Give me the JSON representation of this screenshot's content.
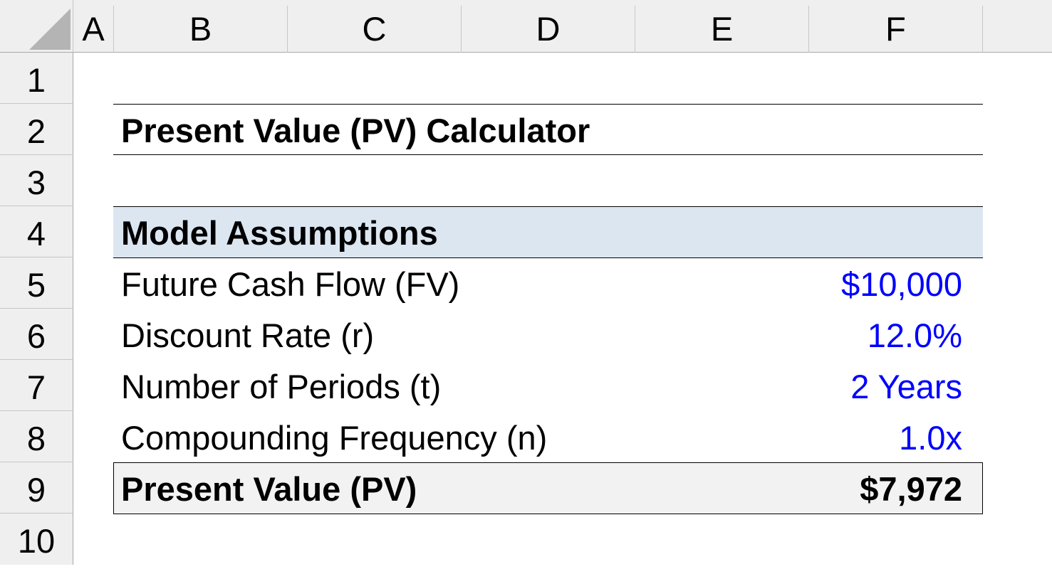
{
  "sheet": {
    "columns": [
      "A",
      "B",
      "C",
      "D",
      "E",
      "F"
    ],
    "rows": [
      "1",
      "2",
      "3",
      "4",
      "5",
      "6",
      "7",
      "8",
      "9",
      "10"
    ]
  },
  "title": "Present Value (PV) Calculator",
  "section_header": "Model Assumptions",
  "assumptions": [
    {
      "label": "Future Cash Flow (FV)",
      "value": "$10,000"
    },
    {
      "label": "Discount Rate (r)",
      "value": "12.0%"
    },
    {
      "label": "Number of Periods (t)",
      "value": "2 Years"
    },
    {
      "label": "Compounding Frequency (n)",
      "value": "1.0x"
    }
  ],
  "result": {
    "label": "Present Value (PV)",
    "value": "$7,972"
  },
  "colors": {
    "input_font": "#0000ff",
    "header_fill": "#dce6f1",
    "result_fill": "#f2f2f2"
  }
}
